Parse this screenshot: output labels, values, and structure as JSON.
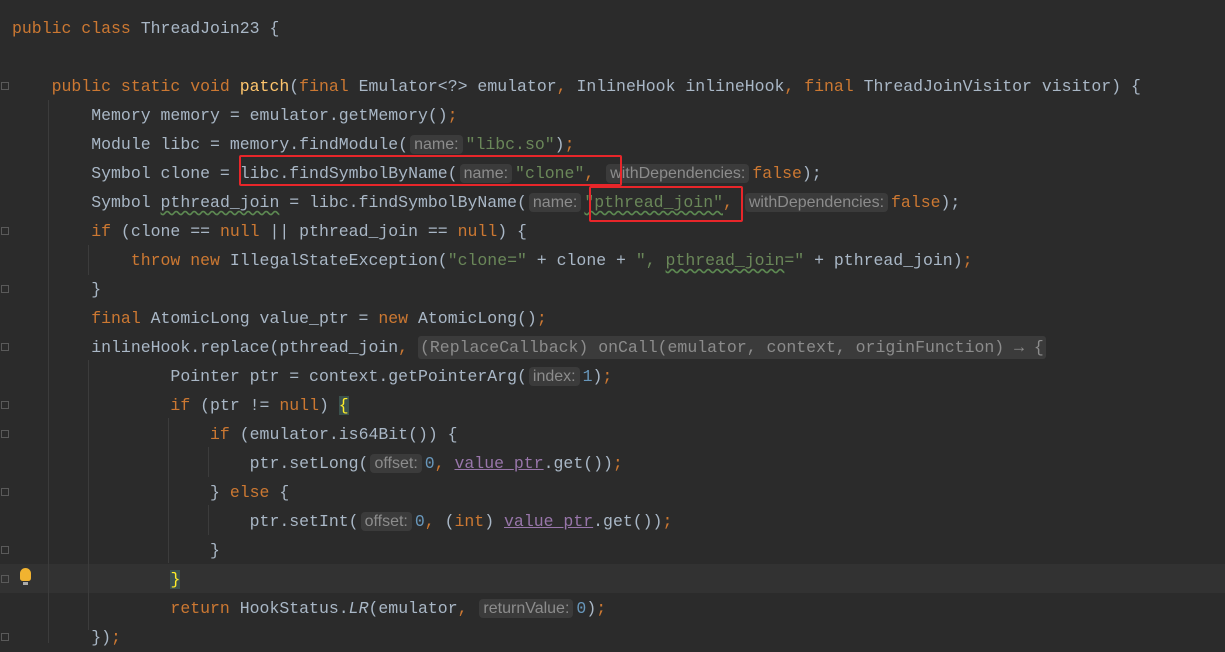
{
  "colors": {
    "background": "#2b2b2b",
    "keyword": "#cc7832",
    "identifier": "#a9b7c6",
    "string": "#6a8759",
    "number": "#6897bb",
    "method_declaration": "#ffc66d",
    "highlight_box": "#e8262a"
  },
  "code": {
    "lines": [
      {
        "tokens": [
          [
            "public class ",
            "kw"
          ],
          [
            "ThreadJoin23 {",
            "id"
          ]
        ]
      },
      {
        "tokens": []
      },
      {
        "tokens": [
          [
            "    public static void ",
            "kw"
          ],
          [
            "patch",
            "fn"
          ],
          [
            "(",
            "id"
          ],
          [
            "final ",
            "kw"
          ],
          [
            "Emulator<?> emulator",
            "id"
          ],
          [
            ", ",
            "kw"
          ],
          [
            "InlineHook inlineHook",
            "id"
          ],
          [
            ", ",
            "kw"
          ],
          [
            "final ",
            "kw"
          ],
          [
            "ThreadJoinVisitor visitor) {",
            "id"
          ]
        ]
      },
      {
        "tokens": [
          [
            "        Memory memory = emulator.getMemory()",
            "id"
          ],
          [
            ";",
            "kw"
          ]
        ]
      },
      {
        "tokens": [
          [
            "        Module libc = memory.findModule(",
            "id"
          ],
          [
            "name:",
            "hint"
          ],
          [
            "\"libc.so\"",
            "str"
          ],
          [
            ")",
            "id"
          ],
          [
            ";",
            "kw"
          ]
        ]
      },
      {
        "tokens": [
          [
            "        Symbol clone = libc.findSymbolByName(",
            "id"
          ],
          [
            "name:",
            "hint"
          ],
          [
            "\"clone\"",
            "str"
          ],
          [
            ", ",
            "kw"
          ],
          [
            "withDependencies:",
            "hint"
          ],
          [
            "false",
            "kw"
          ],
          [
            ");",
            "id"
          ]
        ]
      },
      {
        "tokens": [
          [
            "        Symbol ",
            "id"
          ],
          [
            "pthread_join",
            "wavy"
          ],
          [
            " = libc.findSymbolByName(",
            "id"
          ],
          [
            "name:",
            "hint"
          ],
          [
            "\"pthread_join\"",
            "str wavy"
          ],
          [
            ", ",
            "kw"
          ],
          [
            "withDependencies:",
            "hint"
          ],
          [
            "false",
            "kw"
          ],
          [
            ");",
            "id"
          ]
        ]
      },
      {
        "tokens": [
          [
            "        if ",
            "kw"
          ],
          [
            "(clone == ",
            "id"
          ],
          [
            "null ",
            "kw"
          ],
          [
            "|| pthread_join == ",
            "id"
          ],
          [
            "null",
            "kw"
          ],
          [
            ") {",
            "id"
          ]
        ]
      },
      {
        "tokens": [
          [
            "            throw new ",
            "kw"
          ],
          [
            "IllegalStateException(",
            "id"
          ],
          [
            "\"clone=\"",
            "str"
          ],
          [
            " + clone + ",
            "id"
          ],
          [
            "\", ",
            "str"
          ],
          [
            "pthread_join",
            "str wavy"
          ],
          [
            "=\"",
            "str"
          ],
          [
            " + pthread_join)",
            "id"
          ],
          [
            ";",
            "kw"
          ]
        ]
      },
      {
        "tokens": [
          [
            "        }",
            "id"
          ]
        ]
      },
      {
        "tokens": [
          [
            "        final ",
            "kw"
          ],
          [
            "AtomicLong value_ptr = ",
            "id"
          ],
          [
            "new ",
            "kw"
          ],
          [
            "AtomicLong()",
            "id"
          ],
          [
            ";",
            "kw"
          ]
        ]
      },
      {
        "tokens": [
          [
            "        inlineHook.replace(pthread_join",
            "id"
          ],
          [
            ", ",
            "kw"
          ],
          [
            "(ReplaceCallback) onCall(emulator, context, originFunction) → {",
            "lhint"
          ]
        ]
      },
      {
        "tokens": [
          [
            "                Pointer ptr = context.getPointerArg(",
            "id"
          ],
          [
            "index:",
            "hint"
          ],
          [
            "1",
            "num"
          ],
          [
            ")",
            "id"
          ],
          [
            ";",
            "kw"
          ]
        ]
      },
      {
        "tokens": [
          [
            "                if ",
            "kw"
          ],
          [
            "(ptr != ",
            "id"
          ],
          [
            "null",
            "kw"
          ],
          [
            ") ",
            "id"
          ],
          [
            "{",
            "brace"
          ]
        ]
      },
      {
        "tokens": [
          [
            "                    if ",
            "kw"
          ],
          [
            "(emulator.is64Bit()) {",
            "id"
          ]
        ]
      },
      {
        "tokens": [
          [
            "                        ptr.setLong(",
            "id"
          ],
          [
            "offset:",
            "hint"
          ],
          [
            "0",
            "num"
          ],
          [
            ", ",
            "kw"
          ],
          [
            "value_ptr",
            "fldu"
          ],
          [
            ".get())",
            "id"
          ],
          [
            ";",
            "kw"
          ]
        ]
      },
      {
        "tokens": [
          [
            "                    } ",
            "id"
          ],
          [
            "else ",
            "kw"
          ],
          [
            "{",
            "id"
          ]
        ]
      },
      {
        "tokens": [
          [
            "                        ptr.setInt(",
            "id"
          ],
          [
            "offset:",
            "hint"
          ],
          [
            "0",
            "num"
          ],
          [
            ", ",
            "kw"
          ],
          [
            "(",
            "id"
          ],
          [
            "int",
            "kw"
          ],
          [
            ") ",
            "id"
          ],
          [
            "value_ptr",
            "fldu"
          ],
          [
            ".get())",
            "id"
          ],
          [
            ";",
            "kw"
          ]
        ]
      },
      {
        "tokens": [
          [
            "                    }",
            "id"
          ]
        ]
      },
      {
        "tokens": [
          [
            "                ",
            "id"
          ],
          [
            "}",
            "brace"
          ]
        ]
      },
      {
        "tokens": [
          [
            "                return ",
            "kw"
          ],
          [
            "HookStatus.",
            "id"
          ],
          [
            "LR",
            "id it"
          ],
          [
            "(emulator",
            "id"
          ],
          [
            ", ",
            "kw"
          ],
          [
            "returnValue:",
            "hint"
          ],
          [
            "0",
            "num"
          ],
          [
            ")",
            "id"
          ],
          [
            ";",
            "kw"
          ]
        ]
      },
      {
        "tokens": [
          [
            "        })",
            "id"
          ],
          [
            ";",
            "kw"
          ]
        ]
      }
    ]
  }
}
